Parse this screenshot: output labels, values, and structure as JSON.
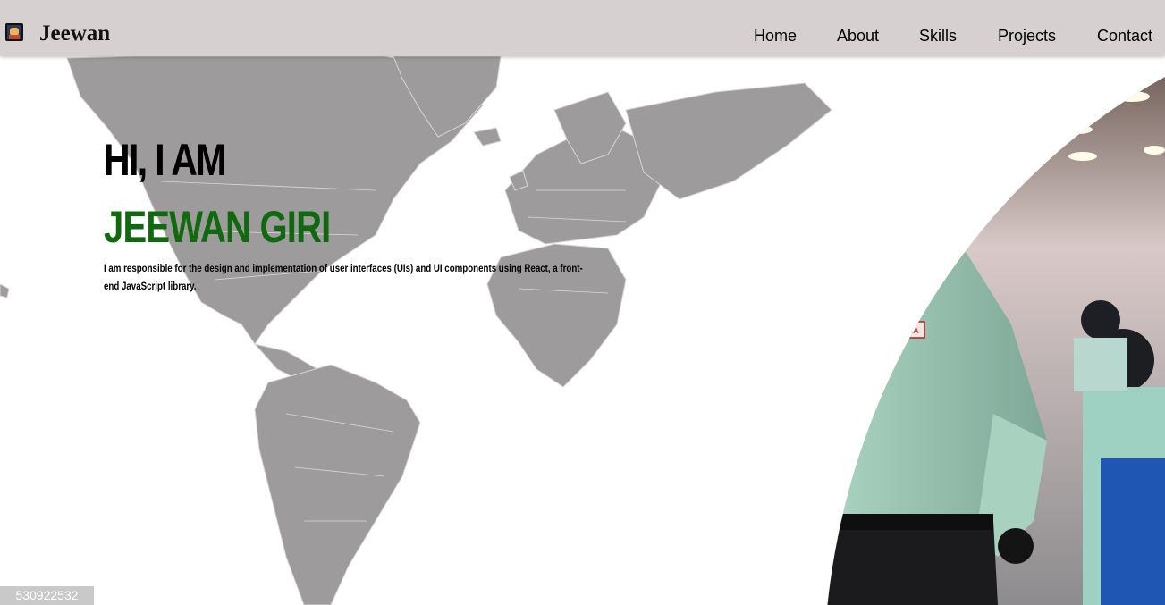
{
  "header": {
    "brand": "Jeewan",
    "logo_icon": "avatar-pixel-icon",
    "nav": [
      "Home",
      "About",
      "Skills",
      "Projects",
      "Contact"
    ]
  },
  "hero": {
    "greeting": "HI, I AM",
    "name": "JEEWAN GIRI",
    "description": "I am responsible for the design and implementation of user interfaces (UIs) and UI components using React, a front-end JavaScript library.",
    "photo_badge": "JANAJYOTI B.C.A"
  },
  "footer": {
    "id_tag": "530922532"
  },
  "colors": {
    "navbar": "#d6d0d0",
    "name_green": "#11690f",
    "map_gray": "#9e9b9c",
    "text": "#000000"
  }
}
